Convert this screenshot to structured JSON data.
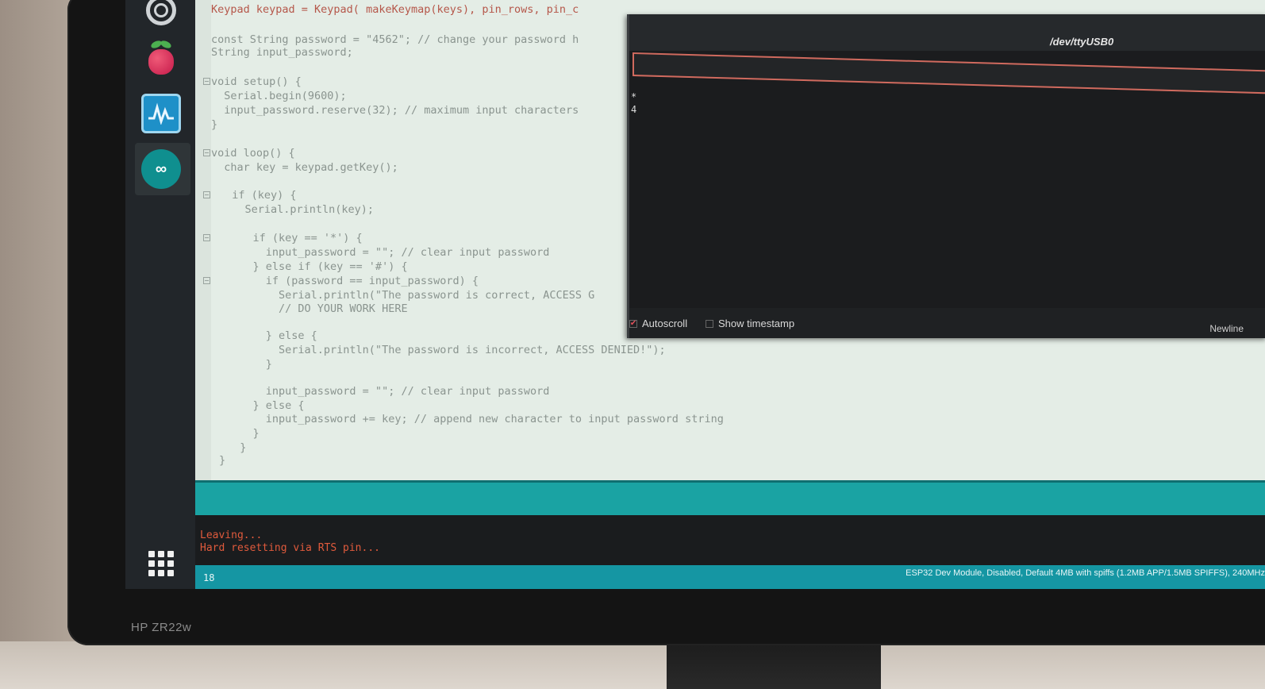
{
  "monitor": {
    "brand": "HP ZR22w"
  },
  "sidebar": {
    "items": [
      {
        "name": "settings"
      },
      {
        "name": "raspberry-pi"
      },
      {
        "name": "serial-plotter"
      },
      {
        "name": "arduino-ide"
      },
      {
        "name": "app-grid"
      }
    ]
  },
  "editor": {
    "lines": [
      "Keypad keypad = Keypad( makeKeymap(keys), pin_rows, pin_c",
      "const String password = \"4562\"; // change your password h",
      "String input_password;",
      "void setup() {",
      "  Serial.begin(9600);",
      "  input_password.reserve(32); // maximum input characters",
      "}",
      "void loop() {",
      "  char key = keypad.getKey();",
      "  if (key) {",
      "    Serial.println(key);",
      "    if (key == '*') {",
      "      input_password = \"\"; // clear input password",
      "    } else if (key == '#') {",
      "      if (password == input_password) {",
      "        Serial.println(\"The password is correct, ACCESS G",
      "        // DO YOUR WORK HERE",
      "      } else {",
      "        Serial.println(\"The password is incorrect, ACCESS DENIED!\");",
      "      }",
      "      input_password = \"\"; // clear input password",
      "    } else {",
      "      input_password += key; // append new character to input password string",
      "    }",
      "  }",
      "}"
    ]
  },
  "console": {
    "lines": [
      "Leaving...",
      "Hard resetting via RTS pin..."
    ]
  },
  "statusbar": {
    "line": "18",
    "board": "ESP32 Dev Module, Disabled, Default 4MB with spiffs (1.2MB APP/1.5MB SPIFFS), 240MHz"
  },
  "serial_monitor": {
    "title": "/dev/ttyUSB0",
    "input_value": "",
    "output": "*\n4",
    "autoscroll_label": "Autoscroll",
    "autoscroll_checked": true,
    "timestamp_label": "Show timestamp",
    "timestamp_checked": false,
    "line_ending": "Newline"
  }
}
